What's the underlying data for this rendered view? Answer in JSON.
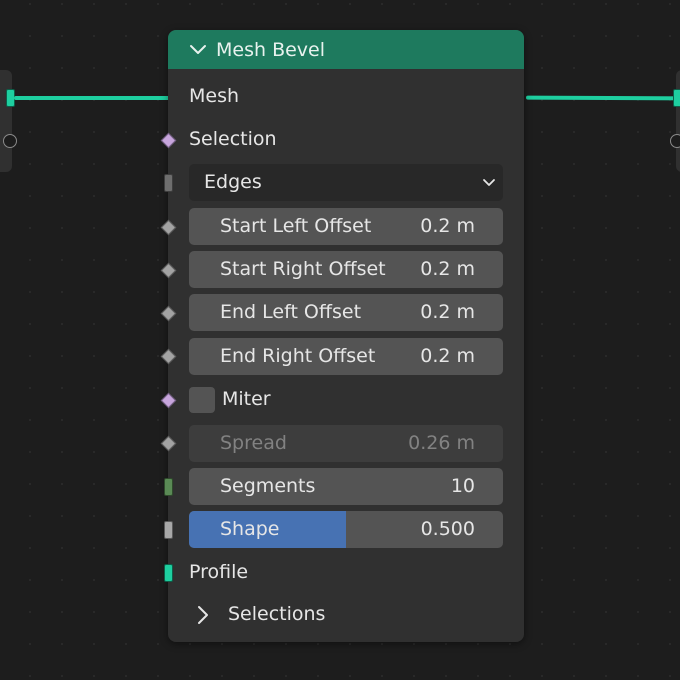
{
  "colors": {
    "canvas": "#1d1d1d",
    "node_body": "#303030",
    "header": "#1e7a5e",
    "geometry_socket": "#1ecfa0",
    "bool_socket": "#c7a5dc",
    "float_socket": "#a3a3a3",
    "int_socket": "#5a8a55",
    "field_bg": "#545454",
    "shape_fill": "#4772b3"
  },
  "node": {
    "title": "Mesh Bevel",
    "collapse_icon": "chevron-down-icon",
    "inputs": {
      "mesh_label": "Mesh",
      "selection_label": "Selection",
      "mode_value": "Edges",
      "start_left_offset": {
        "label": "Start Left Offset",
        "value": "0.2 m"
      },
      "start_right_offset": {
        "label": "Start Right Offset",
        "value": "0.2 m"
      },
      "end_left_offset": {
        "label": "End Left Offset",
        "value": "0.2 m"
      },
      "end_right_offset": {
        "label": "End Right Offset",
        "value": "0.2 m"
      },
      "miter_label": "Miter",
      "spread": {
        "label": "Spread",
        "value": "0.26 m"
      },
      "segments": {
        "label": "Segments",
        "value": "10"
      },
      "shape": {
        "label": "Shape",
        "value": "0.500",
        "fraction": 0.5
      },
      "profile_label": "Profile"
    },
    "panel": {
      "label": "Selections",
      "expand_icon": "chevron-right-icon"
    }
  }
}
